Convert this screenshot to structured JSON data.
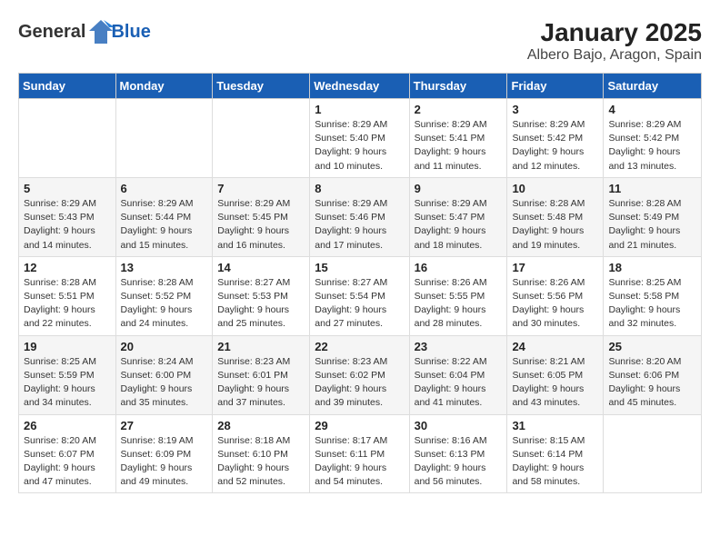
{
  "logo": {
    "general": "General",
    "blue": "Blue"
  },
  "title": "January 2025",
  "location": "Albero Bajo, Aragon, Spain",
  "days_of_week": [
    "Sunday",
    "Monday",
    "Tuesday",
    "Wednesday",
    "Thursday",
    "Friday",
    "Saturday"
  ],
  "weeks": [
    [
      {
        "day": "",
        "detail": ""
      },
      {
        "day": "",
        "detail": ""
      },
      {
        "day": "",
        "detail": ""
      },
      {
        "day": "1",
        "detail": "Sunrise: 8:29 AM\nSunset: 5:40 PM\nDaylight: 9 hours and 10 minutes."
      },
      {
        "day": "2",
        "detail": "Sunrise: 8:29 AM\nSunset: 5:41 PM\nDaylight: 9 hours and 11 minutes."
      },
      {
        "day": "3",
        "detail": "Sunrise: 8:29 AM\nSunset: 5:42 PM\nDaylight: 9 hours and 12 minutes."
      },
      {
        "day": "4",
        "detail": "Sunrise: 8:29 AM\nSunset: 5:42 PM\nDaylight: 9 hours and 13 minutes."
      }
    ],
    [
      {
        "day": "5",
        "detail": "Sunrise: 8:29 AM\nSunset: 5:43 PM\nDaylight: 9 hours and 14 minutes."
      },
      {
        "day": "6",
        "detail": "Sunrise: 8:29 AM\nSunset: 5:44 PM\nDaylight: 9 hours and 15 minutes."
      },
      {
        "day": "7",
        "detail": "Sunrise: 8:29 AM\nSunset: 5:45 PM\nDaylight: 9 hours and 16 minutes."
      },
      {
        "day": "8",
        "detail": "Sunrise: 8:29 AM\nSunset: 5:46 PM\nDaylight: 9 hours and 17 minutes."
      },
      {
        "day": "9",
        "detail": "Sunrise: 8:29 AM\nSunset: 5:47 PM\nDaylight: 9 hours and 18 minutes."
      },
      {
        "day": "10",
        "detail": "Sunrise: 8:28 AM\nSunset: 5:48 PM\nDaylight: 9 hours and 19 minutes."
      },
      {
        "day": "11",
        "detail": "Sunrise: 8:28 AM\nSunset: 5:49 PM\nDaylight: 9 hours and 21 minutes."
      }
    ],
    [
      {
        "day": "12",
        "detail": "Sunrise: 8:28 AM\nSunset: 5:51 PM\nDaylight: 9 hours and 22 minutes."
      },
      {
        "day": "13",
        "detail": "Sunrise: 8:28 AM\nSunset: 5:52 PM\nDaylight: 9 hours and 24 minutes."
      },
      {
        "day": "14",
        "detail": "Sunrise: 8:27 AM\nSunset: 5:53 PM\nDaylight: 9 hours and 25 minutes."
      },
      {
        "day": "15",
        "detail": "Sunrise: 8:27 AM\nSunset: 5:54 PM\nDaylight: 9 hours and 27 minutes."
      },
      {
        "day": "16",
        "detail": "Sunrise: 8:26 AM\nSunset: 5:55 PM\nDaylight: 9 hours and 28 minutes."
      },
      {
        "day": "17",
        "detail": "Sunrise: 8:26 AM\nSunset: 5:56 PM\nDaylight: 9 hours and 30 minutes."
      },
      {
        "day": "18",
        "detail": "Sunrise: 8:25 AM\nSunset: 5:58 PM\nDaylight: 9 hours and 32 minutes."
      }
    ],
    [
      {
        "day": "19",
        "detail": "Sunrise: 8:25 AM\nSunset: 5:59 PM\nDaylight: 9 hours and 34 minutes."
      },
      {
        "day": "20",
        "detail": "Sunrise: 8:24 AM\nSunset: 6:00 PM\nDaylight: 9 hours and 35 minutes."
      },
      {
        "day": "21",
        "detail": "Sunrise: 8:23 AM\nSunset: 6:01 PM\nDaylight: 9 hours and 37 minutes."
      },
      {
        "day": "22",
        "detail": "Sunrise: 8:23 AM\nSunset: 6:02 PM\nDaylight: 9 hours and 39 minutes."
      },
      {
        "day": "23",
        "detail": "Sunrise: 8:22 AM\nSunset: 6:04 PM\nDaylight: 9 hours and 41 minutes."
      },
      {
        "day": "24",
        "detail": "Sunrise: 8:21 AM\nSunset: 6:05 PM\nDaylight: 9 hours and 43 minutes."
      },
      {
        "day": "25",
        "detail": "Sunrise: 8:20 AM\nSunset: 6:06 PM\nDaylight: 9 hours and 45 minutes."
      }
    ],
    [
      {
        "day": "26",
        "detail": "Sunrise: 8:20 AM\nSunset: 6:07 PM\nDaylight: 9 hours and 47 minutes."
      },
      {
        "day": "27",
        "detail": "Sunrise: 8:19 AM\nSunset: 6:09 PM\nDaylight: 9 hours and 49 minutes."
      },
      {
        "day": "28",
        "detail": "Sunrise: 8:18 AM\nSunset: 6:10 PM\nDaylight: 9 hours and 52 minutes."
      },
      {
        "day": "29",
        "detail": "Sunrise: 8:17 AM\nSunset: 6:11 PM\nDaylight: 9 hours and 54 minutes."
      },
      {
        "day": "30",
        "detail": "Sunrise: 8:16 AM\nSunset: 6:13 PM\nDaylight: 9 hours and 56 minutes."
      },
      {
        "day": "31",
        "detail": "Sunrise: 8:15 AM\nSunset: 6:14 PM\nDaylight: 9 hours and 58 minutes."
      },
      {
        "day": "",
        "detail": ""
      }
    ]
  ]
}
